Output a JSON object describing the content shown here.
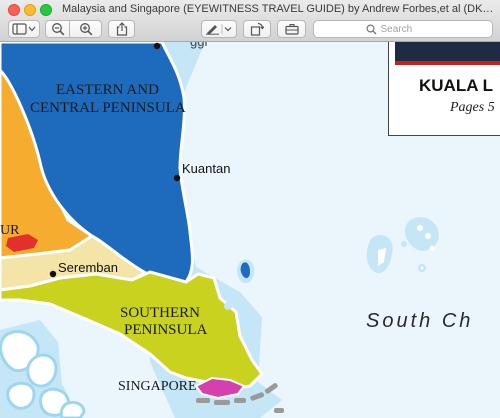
{
  "window": {
    "title": "Malaysia and Singapore (EYEWITNESS TRAVEL GUIDE) by Andrew Forbes,et al (DK, 20..."
  },
  "toolbar": {
    "search_placeholder": "Search",
    "buttons": [
      {
        "name": "sidebar-toggle-button",
        "icon": "sidebar-icon"
      },
      {
        "name": "zoom-out-button",
        "icon": "zoom-out-icon"
      },
      {
        "name": "zoom-in-button",
        "icon": "zoom-in-icon"
      },
      {
        "name": "share-button",
        "icon": "share-icon"
      },
      {
        "name": "markup-button",
        "icon": "pen-icon"
      },
      {
        "name": "rotate-button",
        "icon": "rotate-icon"
      },
      {
        "name": "toolbox-button",
        "icon": "toolbox-icon"
      }
    ]
  },
  "map": {
    "regions": {
      "eastern_central_line1": "EASTERN AND",
      "eastern_central_line2": "CENTRAL PENINSULA",
      "southern_line1": "SOUTHERN",
      "southern_line2": "PENINSULA",
      "singapore": "SINGAPORE",
      "left_partial": "UR"
    },
    "towns": {
      "kuantan": "Kuantan",
      "seremban": "Seremban"
    },
    "sea": "South Ch",
    "inset": {
      "title": "KUALA L",
      "pages": "Pages 5"
    },
    "colors": {
      "water": "#eaf6fc",
      "shallow_water": "#c4e6f6",
      "eastern_central": "#1e6bbd",
      "southern": "#c9d21f",
      "central_west": "#f6ad2f",
      "kl_red": "#e3302a",
      "singapore": "#d53fae",
      "land_outline": "#ffffff"
    }
  }
}
